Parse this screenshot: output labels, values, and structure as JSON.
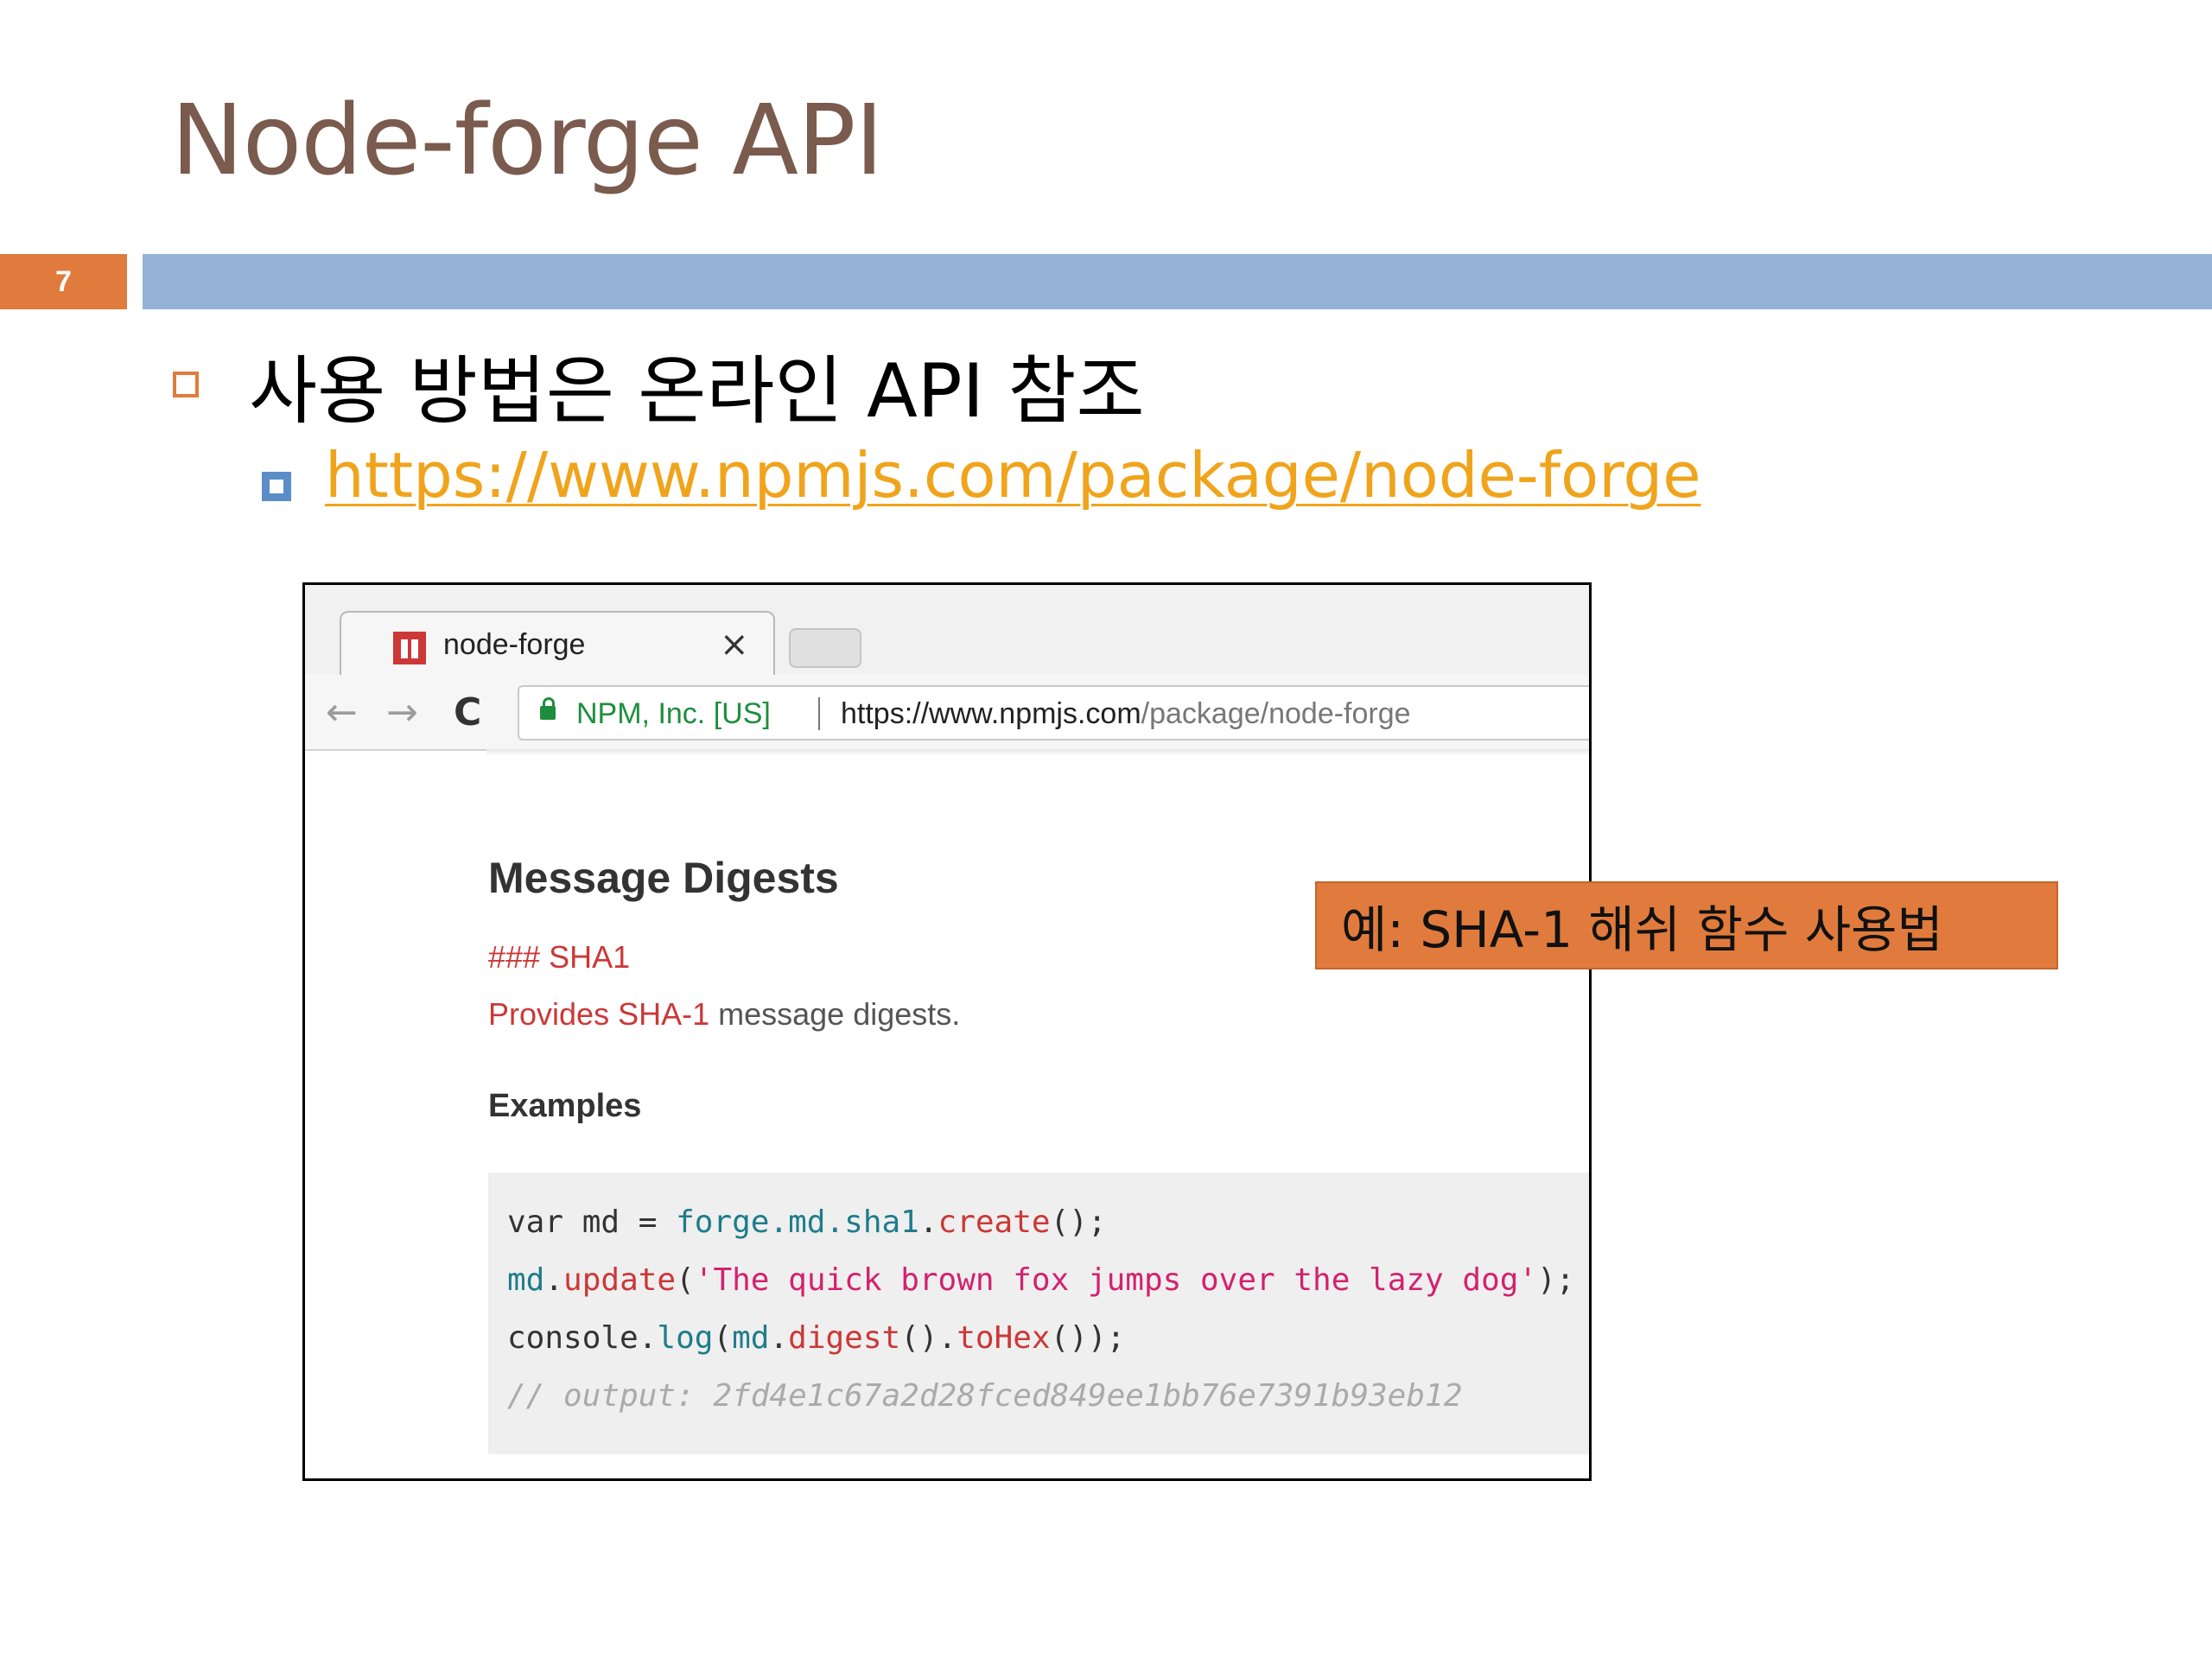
{
  "slide": {
    "title": "Node-forge API",
    "number": "7",
    "bullet1": "사용 방법은 온라인 API 참조",
    "link": "https://www.npmjs.com/package/node-forge",
    "callout": "예: SHA-1 해쉬 함수 사용법"
  },
  "browser": {
    "tab_title": "node-forge",
    "tab_close": "×",
    "back_icon": "←",
    "forward_icon": "→",
    "reload_icon": "C",
    "org": "NPM, Inc. [US]",
    "url_host": "https://www.npmjs.com",
    "url_path": "/package/node-forge"
  },
  "page": {
    "heading": "Message Digests",
    "sha_heading": "### SHA1",
    "provides_em": "Provides SHA-1",
    "provides_rest": " message digests.",
    "examples": "Examples"
  },
  "code": {
    "l1_a": "var md = ",
    "l1_b": "forge.md.sha1",
    "l1_c": ".",
    "l1_d": "create",
    "l1_e": "();",
    "l2_a": "md",
    "l2_b": ".",
    "l2_c": "update",
    "l2_d": "(",
    "l2_e": "'The quick brown fox jumps over the lazy dog'",
    "l2_f": ");",
    "l3_a": "console.",
    "l3_b": "log",
    "l3_c": "(",
    "l3_d": "md",
    "l3_e": ".",
    "l3_f": "digest",
    "l3_g": "().",
    "l3_h": "toHex",
    "l3_i": "());",
    "l4": "// output: 2fd4e1c67a2d28fced849ee1bb76e7391b93eb12"
  },
  "colors": {
    "title": "#7a5b4e",
    "accent_orange": "#e07b3d",
    "band_blue": "#95b3d7",
    "link": "#f0a41c",
    "npm_red": "#cb3837"
  }
}
